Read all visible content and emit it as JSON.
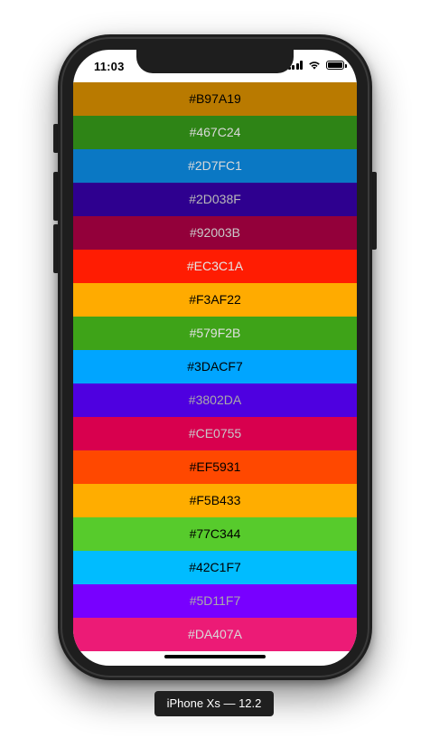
{
  "status_bar": {
    "time": "11:03"
  },
  "colors": [
    {
      "hex": "#B97A19",
      "text_color": "#000000"
    },
    {
      "hex": "#467C24",
      "text_color": "#d9d9d9"
    },
    {
      "hex": "#2D7FC1",
      "text_color": "#d9d9d9"
    },
    {
      "hex": "#2D038F",
      "text_color": "#b9b9b9"
    },
    {
      "hex": "#92003B",
      "text_color": "#c9c9c9"
    },
    {
      "hex": "#EC3C1A",
      "text_color": "#e5e5e5"
    },
    {
      "hex": "#F3AF22",
      "text_color": "#000000"
    },
    {
      "hex": "#579F2B",
      "text_color": "#e0e0e0"
    },
    {
      "hex": "#3DACF7",
      "text_color": "#000000"
    },
    {
      "hex": "#3802DA",
      "text_color": "#aaaaaa"
    },
    {
      "hex": "#CE0755",
      "text_color": "#c9c9c9"
    },
    {
      "hex": "#EF5931",
      "text_color": "#000000"
    },
    {
      "hex": "#F5B433",
      "text_color": "#000000"
    },
    {
      "hex": "#77C344",
      "text_color": "#000000"
    },
    {
      "hex": "#42C1F7",
      "text_color": "#000000"
    },
    {
      "hex": "#5D11F7",
      "text_color": "#aaaaaa"
    },
    {
      "hex": "#DA407A",
      "text_color": "#d9d9d9"
    }
  ],
  "row_fill": {
    "#B97A19": "#b97a00",
    "#467C24": "#2e8416",
    "#2D7FC1": "#0a78c4",
    "#2D038F": "#2e008f",
    "#92003B": "#93003a",
    "#EC3C1A": "#ff1c02",
    "#F3AF22": "#ffab00",
    "#579F2B": "#3ea318",
    "#3DACF7": "#00a5ff",
    "#3802DA": "#4e00e0",
    "#CE0755": "#d8004e",
    "#EF5931": "#ff4800",
    "#F5B433": "#ffad00",
    "#77C344": "#57cb2c",
    "#42C1F7": "#00bcff",
    "#5D11F7": "#7800ff",
    "#DA407A": "#ec1b76"
  },
  "device_label": "iPhone Xs — 12.2"
}
